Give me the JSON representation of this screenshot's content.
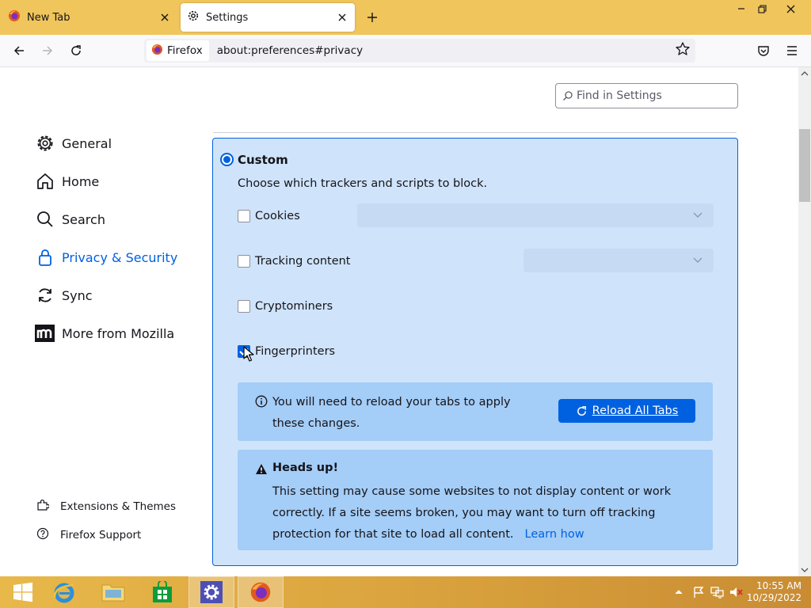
{
  "browser": {
    "tabs": [
      {
        "title": "New Tab",
        "icon": "firefox-icon",
        "active": false
      },
      {
        "title": "Settings",
        "icon": "gear-icon",
        "active": true
      }
    ],
    "identity_label": "Firefox",
    "url": "about:preferences#privacy"
  },
  "settings": {
    "search_placeholder": "Find in Settings",
    "nav": {
      "general": "General",
      "home": "Home",
      "search": "Search",
      "privacy": "Privacy & Security",
      "sync": "Sync",
      "mozilla": "More from Mozilla",
      "extensions": "Extensions & Themes",
      "support": "Firefox Support"
    },
    "custom": {
      "label": "Custom",
      "description": "Choose which trackers and scripts to block.",
      "options": [
        {
          "label": "Cookies",
          "checked": false
        },
        {
          "label": "Tracking content",
          "checked": false
        },
        {
          "label": "Cryptominers",
          "checked": false
        },
        {
          "label": "Fingerprinters",
          "checked": true
        }
      ],
      "reload_message": "You will need to reload your tabs to apply these changes.",
      "reload_button": "Reload All Tabs",
      "warning_title": "Heads up!",
      "warning_message": "This setting may cause some websites to not display content or work correctly. If a site seems broken, you may want to turn off tracking protection for that site to load all content.",
      "learn_how": "Learn how"
    }
  },
  "taskbar": {
    "time": "10:55 AM",
    "date": "10/29/2022"
  },
  "colors": {
    "accent": "#0061e0",
    "tabstrip": "#f0c55b",
    "custom_bg": "#cfe4fb",
    "notice_bg": "#a4cdf7"
  }
}
